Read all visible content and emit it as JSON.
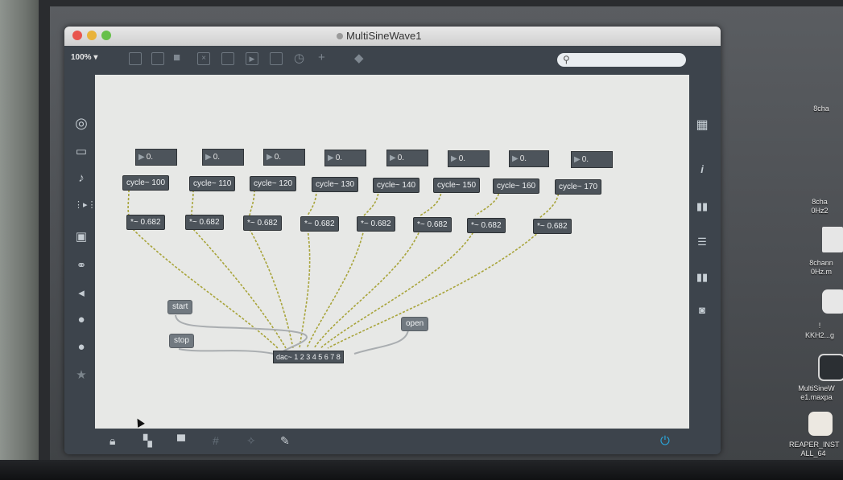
{
  "window": {
    "title": "MultiSineWave1",
    "zoom": "100%",
    "zoom_arrow": "▾"
  },
  "toolbar_icons": [
    "new-object-icon",
    "new-message-icon",
    "comment-icon",
    "button-icon",
    "toggle-icon",
    "number-icon",
    "slider-icon",
    "dial-icon",
    "add-icon",
    "paint-bucket-icon"
  ],
  "search": {
    "placeholder": "",
    "icon": "search-icon"
  },
  "left_sidebar": [
    "target-icon",
    "display-icon",
    "music-note-icon",
    "sequence-icon",
    "image-icon",
    "link-icon",
    "plug-icon",
    "circle-icon-1",
    "circle-icon-2",
    "star-icon"
  ],
  "right_sidebar": [
    "grid-icon",
    "info-icon",
    "book-icon",
    "list-icon",
    "tiles-icon",
    "camera-icon"
  ],
  "bottom_bar": [
    "lock-icon",
    "presentation-icon",
    "projector-icon",
    "grid-toggle-icon",
    "cursor-icon",
    "wrench-icon",
    "power-icon"
  ],
  "patch": {
    "number_boxes": [
      "0.",
      "0.",
      "0.",
      "0.",
      "0.",
      "0.",
      "0.",
      "0."
    ],
    "oscillators": [
      "cycle~ 100",
      "cycle~ 110",
      "cycle~ 120",
      "cycle~ 130",
      "cycle~ 140",
      "cycle~ 150",
      "cycle~ 160",
      "cycle~ 170"
    ],
    "gains": [
      "*~ 0.682",
      "*~ 0.682",
      "*~ 0.682",
      "*~ 0.682",
      "*~ 0.682",
      "*~ 0.682",
      "*~ 0.682",
      "*~ 0.682"
    ],
    "messages": {
      "start": "start",
      "stop": "stop",
      "open": "open"
    },
    "dac": "dac~ 1 2 3 4 5 6 7 8"
  },
  "desktop": {
    "items": [
      {
        "label_1": "8cha",
        "label_2": "0Hz2"
      },
      {
        "label_1": "8chann",
        "label_2": "0Hz.m"
      },
      {
        "label_1": "!",
        "label_2": "KKH2...g"
      },
      {
        "label_1": "MultiSineW",
        "label_2": "e1.maxpa"
      },
      {
        "label_1": "REAPER_INST",
        "label_2": "ALL_64"
      }
    ]
  },
  "colors": {
    "patch_cord": "#a8a43a",
    "signal_dash": "#5b9a3a",
    "meter_blue": "#1f8fb3",
    "power_blue": "#2aa5d9"
  }
}
